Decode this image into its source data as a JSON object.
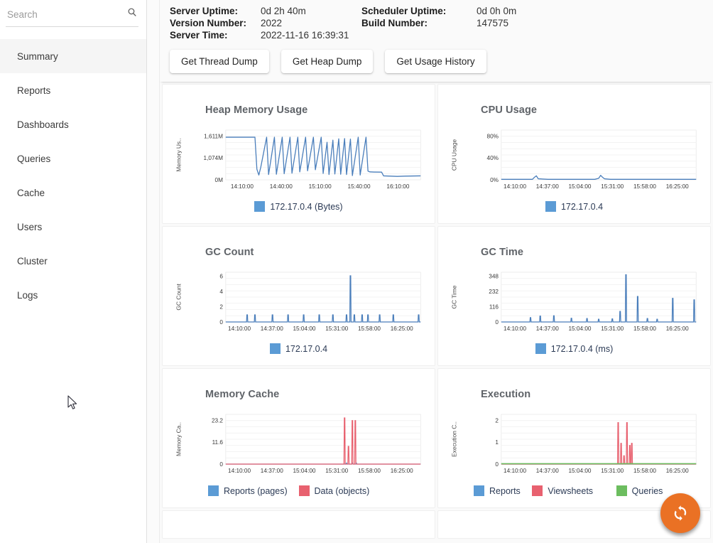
{
  "sidebar": {
    "search": {
      "placeholder": "Search",
      "value": "",
      "icon": "search-icon"
    },
    "items": [
      {
        "label": "Summary",
        "selected": true
      },
      {
        "label": "Reports",
        "selected": false
      },
      {
        "label": "Dashboards",
        "selected": false
      },
      {
        "label": "Queries",
        "selected": false
      },
      {
        "label": "Cache",
        "selected": false
      },
      {
        "label": "Users",
        "selected": false
      },
      {
        "label": "Cluster",
        "selected": false
      },
      {
        "label": "Logs",
        "selected": false
      }
    ]
  },
  "header": {
    "info": [
      {
        "label": "Server Uptime:",
        "value": "0d 2h 40m"
      },
      {
        "label": "Scheduler Uptime:",
        "value": "0d 0h 0m"
      },
      {
        "label": "Version Number:",
        "value": "2022"
      },
      {
        "label": "Build Number:",
        "value": "147575"
      },
      {
        "label": "Server Time:",
        "value": "2022-11-16 16:39:31"
      }
    ],
    "buttons": [
      {
        "label": "Get Thread Dump"
      },
      {
        "label": "Get Heap Dump"
      },
      {
        "label": "Get Usage History"
      }
    ]
  },
  "fab": {
    "icon": "refresh-icon",
    "color": "#ea7124",
    "label": "Refresh"
  },
  "colors": {
    "series_blue": "#4a7ebb",
    "legend_blue": "#5b9bd5",
    "series_red": "#e8616f",
    "series_green": "#6cbd5f",
    "title_gray": "#5f6368",
    "grid": "#ebebeb"
  },
  "chart_data": [
    {
      "type": "line",
      "title": "Heap Memory Usage",
      "xlabel": "",
      "ylabel": "Memory Us..",
      "yticks": [
        "0M",
        "1,074M",
        "1,611M"
      ],
      "ylim": [
        0,
        1880
      ],
      "xticks": [
        "14:10:00",
        "14:40:00",
        "15:10:00",
        "15:40:00",
        "16:10:00"
      ],
      "grid": true,
      "legend": [
        {
          "name": "172.17.0.4 (Bytes)",
          "color": "#5b9bd5"
        }
      ],
      "series": [
        {
          "name": "172.17.0.4 (Bytes)",
          "color": "#4a7ebb",
          "x": [
            0,
            5,
            10,
            14,
            15,
            16,
            17,
            18,
            21,
            22,
            25,
            26,
            29,
            30,
            33,
            34,
            37,
            38,
            41,
            42,
            45,
            46,
            49,
            50,
            52,
            53,
            55,
            56,
            58,
            59,
            61,
            62,
            64,
            65,
            68,
            69,
            72,
            73,
            74,
            76,
            80,
            81,
            88,
            92,
            100
          ],
          "values": [
            1611,
            1611,
            1611,
            1611,
            1611,
            400,
            180,
            480,
            1611,
            200,
            1611,
            210,
            1611,
            230,
            1611,
            250,
            1611,
            300,
            1611,
            340,
            1611,
            380,
            1611,
            240,
            1420,
            200,
            1500,
            220,
            1550,
            210,
            1560,
            200,
            1540,
            160,
            1611,
            180,
            1611,
            330,
            300,
            295,
            290,
            150,
            130,
            140,
            150
          ]
        }
      ]
    },
    {
      "type": "line",
      "title": "CPU Usage",
      "xlabel": "",
      "ylabel": "CPU Usage",
      "yticks": [
        "0%",
        "40%",
        "80%"
      ],
      "ylim": [
        0,
        100
      ],
      "xticks": [
        "14:10:00",
        "14:37:00",
        "15:04:00",
        "15:31:00",
        "15:58:00",
        "16:25:00"
      ],
      "grid": true,
      "legend": [
        {
          "name": "172.17.0.4",
          "color": "#5b9bd5"
        }
      ],
      "series": [
        {
          "name": "172.17.0.4",
          "color": "#4a7ebb",
          "x": [
            0,
            8,
            16,
            17,
            18,
            19,
            24,
            32,
            40,
            48,
            50,
            51,
            52,
            53,
            56,
            60,
            64,
            72,
            80,
            88,
            96,
            100
          ],
          "values": [
            1,
            1,
            1,
            5,
            8,
            2,
            1,
            1,
            1,
            1,
            3,
            9,
            5,
            2,
            1,
            1,
            1,
            1,
            1,
            1,
            1,
            1
          ]
        }
      ]
    },
    {
      "type": "line",
      "title": "GC Count",
      "xlabel": "",
      "ylabel": "GC Count",
      "yticks": [
        "0",
        "2",
        "4",
        "6"
      ],
      "ylim": [
        0,
        7
      ],
      "xticks": [
        "14:10:00",
        "14:37:00",
        "15:04:00",
        "15:31:00",
        "15:58:00",
        "16:25:00"
      ],
      "grid": true,
      "legend": [
        {
          "name": "172.17.0.4",
          "color": "#5b9bd5"
        }
      ],
      "series": [
        {
          "name": "172.17.0.4",
          "color": "#4a7ebb",
          "spikes": [
            {
              "x": 11,
              "y": 1
            },
            {
              "x": 15,
              "y": 1
            },
            {
              "x": 24,
              "y": 1
            },
            {
              "x": 32,
              "y": 1
            },
            {
              "x": 40,
              "y": 1
            },
            {
              "x": 48,
              "y": 1
            },
            {
              "x": 55,
              "y": 1
            },
            {
              "x": 62,
              "y": 1
            },
            {
              "x": 64,
              "y": 6.5
            },
            {
              "x": 66,
              "y": 1
            },
            {
              "x": 70,
              "y": 1
            },
            {
              "x": 73,
              "y": 1
            },
            {
              "x": 79,
              "y": 1
            },
            {
              "x": 86,
              "y": 1
            },
            {
              "x": 99,
              "y": 1
            }
          ]
        }
      ]
    },
    {
      "type": "line",
      "title": "GC Time",
      "xlabel": "",
      "ylabel": "GC Time",
      "yticks": [
        "0",
        "116",
        "232",
        "348"
      ],
      "ylim": [
        0,
        400
      ],
      "xticks": [
        "14:10:00",
        "14:37:00",
        "15:04:00",
        "15:31:00",
        "15:58:00",
        "16:25:00"
      ],
      "grid": true,
      "legend": [
        {
          "name": "172.17.0.4 (ms)",
          "color": "#5b9bd5"
        }
      ],
      "series": [
        {
          "name": "172.17.0.4 (ms)",
          "color": "#4a7ebb",
          "spikes": [
            {
              "x": 15,
              "y": 35
            },
            {
              "x": 20,
              "y": 48
            },
            {
              "x": 27,
              "y": 50
            },
            {
              "x": 36,
              "y": 30
            },
            {
              "x": 44,
              "y": 28
            },
            {
              "x": 50,
              "y": 22
            },
            {
              "x": 57,
              "y": 25
            },
            {
              "x": 61,
              "y": 85
            },
            {
              "x": 64,
              "y": 380
            },
            {
              "x": 70,
              "y": 205
            },
            {
              "x": 75,
              "y": 28
            },
            {
              "x": 80,
              "y": 22
            },
            {
              "x": 88,
              "y": 190
            },
            {
              "x": 99,
              "y": 178
            }
          ]
        }
      ]
    },
    {
      "type": "line",
      "title": "Memory Cache",
      "xlabel": "",
      "ylabel": "Memory Ca..",
      "yticks": [
        "0",
        "11.6",
        "23.2"
      ],
      "ylim": [
        0,
        28
      ],
      "xticks": [
        "14:10:00",
        "14:37:00",
        "15:04:00",
        "15:31:00",
        "15:58:00",
        "16:25:00"
      ],
      "grid": true,
      "legend": [
        {
          "name": "Reports (pages)",
          "color": "#5b9bd5"
        },
        {
          "name": "Data (objects)",
          "color": "#e8616f"
        }
      ],
      "series": [
        {
          "name": "Reports (pages)",
          "color": "#5b9bd5",
          "spikes": [
            {
              "x": 62,
              "y": 0.6
            },
            {
              "x": 65,
              "y": 0.6
            },
            {
              "x": 67,
              "y": 0.6
            }
          ]
        },
        {
          "name": "Data (objects)",
          "color": "#e8616f",
          "spikes": [
            {
              "x": 61,
              "y": 26
            },
            {
              "x": 63,
              "y": 10
            },
            {
              "x": 65,
              "y": 24.5
            },
            {
              "x": 66.5,
              "y": 24.5
            }
          ]
        }
      ]
    },
    {
      "type": "line",
      "title": "Execution",
      "xlabel": "",
      "ylabel": "Execution C..",
      "yticks": [
        "0",
        "1",
        "2"
      ],
      "ylim": [
        0,
        2.4
      ],
      "xticks": [
        "14:10:00",
        "14:37:00",
        "15:04:00",
        "15:31:00",
        "15:58:00",
        "16:25:00"
      ],
      "grid": true,
      "legend": [
        {
          "name": "Reports",
          "color": "#5b9bd5"
        },
        {
          "name": "Viewsheets",
          "color": "#e8616f"
        },
        {
          "name": "Queries",
          "color": "#6cbd5f"
        }
      ],
      "series": [
        {
          "name": "Reports",
          "color": "#5b9bd5",
          "spikes": []
        },
        {
          "name": "Viewsheets",
          "color": "#e8616f",
          "spikes": [
            {
              "x": 60,
              "y": 2
            },
            {
              "x": 61.5,
              "y": 1
            },
            {
              "x": 63,
              "y": 0.4
            },
            {
              "x": 64.5,
              "y": 2
            },
            {
              "x": 66,
              "y": 0.9
            },
            {
              "x": 67,
              "y": 1
            }
          ]
        },
        {
          "name": "Queries",
          "color": "#6cbd5f",
          "baseline": true,
          "spikes": []
        }
      ]
    }
  ]
}
